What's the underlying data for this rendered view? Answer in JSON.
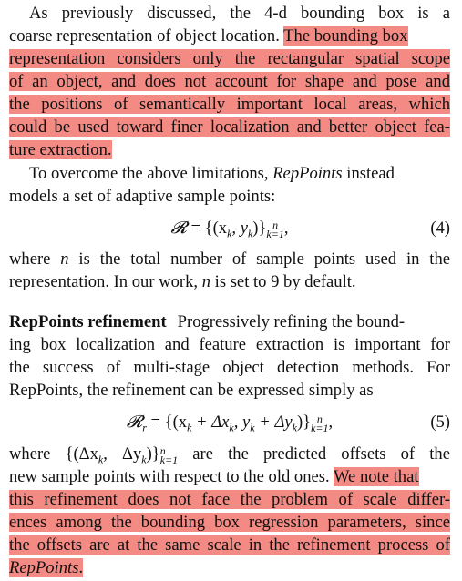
{
  "para1": {
    "l1": "As previously discussed, the 4-d bounding box is a",
    "l2a": "coarse representation of object location. ",
    "l2b": "The bounding box",
    "l3": "representation considers only the rectangular spatial scope",
    "l4": "of an object, and does not account for shape and pose and",
    "l5": "the positions of semantically important local areas, which",
    "l6": "could be used toward finer localization and better object fea-",
    "l7": "ture extraction."
  },
  "para2": {
    "l1a": "To overcome the above limitations, ",
    "l1b": "RepPoints",
    "l1c": " instead",
    "l2": "models a set of adaptive sample points:"
  },
  "eq4": {
    "lhs": "𝓡",
    "eq": " = {(x",
    "sub1": "k",
    "mid": ", y",
    "sub2": "k",
    "close": ")}",
    "sup": "n",
    "sub3": "k=1",
    "end": ",",
    "number": "(4)"
  },
  "para3": {
    "l1a": "where ",
    "l1b": "n",
    "l1c": " is the total number of sample points used in the",
    "l2a": "representation. In our work, ",
    "l2b": "n",
    "l2c": " is set to 9 by default."
  },
  "section": {
    "heading": "RepPoints refinement",
    "l1": "Progressively refining the bound-",
    "l2": "ing box localization and feature extraction is important for",
    "l3": "the success of multi-stage object detection methods. For",
    "l4": "RepPoints, the refinement can be expressed simply as"
  },
  "eq5": {
    "lhs": "𝓡",
    "lhs_sub": "r",
    "eq": " = {(x",
    "sub1": "k",
    "p1": " + Δx",
    "sub2": "k",
    "p2": ", y",
    "sub3": "k",
    "p3": " + Δy",
    "sub4": "k",
    "close": ")}",
    "sup": "n",
    "sub5": "k=1",
    "end": ",",
    "number": "(5)"
  },
  "para4": {
    "l1a": "where {(Δx",
    "l1sub1": "k",
    "l1b": ", Δy",
    "l1sub2": "k",
    "l1c": ")}",
    "l1sup": "n",
    "l1sub3": "k=1",
    "l1d": " are the predicted offsets of the",
    "l2a": "new sample points with respect to the old ones. ",
    "l2b": "We note that",
    "l3": "this refinement does not face the problem of scale differ-",
    "l4": "ences among the bounding box regression parameters, since",
    "l5": "the offsets are at the same scale in the refinement process of",
    "l6a": "RepPoints",
    "l6b": "."
  },
  "colors": {
    "highlight": "#f48a84",
    "text": "#111111"
  }
}
